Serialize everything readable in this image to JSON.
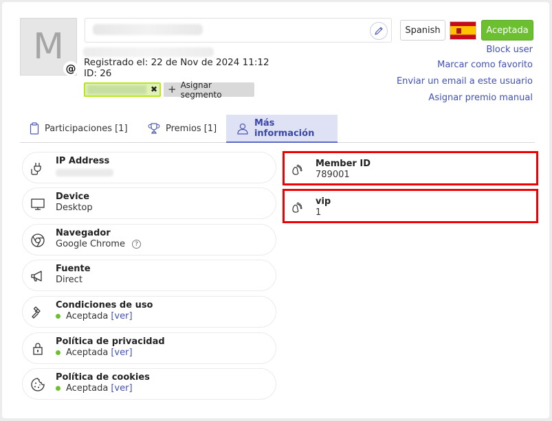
{
  "profile": {
    "avatar_letter": "M",
    "at_symbol": "@",
    "registered": "Registrado el: 22 de Nov de 2024 11:12",
    "id_label": "ID: 26",
    "segment_remove": "✖",
    "assign_segment": "Asignar segmento"
  },
  "header": {
    "language": "Spanish",
    "status": "Aceptada",
    "flag_country": "Spain",
    "colors": {
      "accent": "#4150b5",
      "status_green": "#6cc02f",
      "segment_border": "#b5e81c",
      "highlight_red": "#ee0000"
    }
  },
  "actions": [
    {
      "label": "Block user"
    },
    {
      "label": "Marcar como favorito"
    },
    {
      "label": "Enviar un email a este usuario"
    },
    {
      "label": "Asignar premio manual"
    }
  ],
  "tabs": [
    {
      "label": "Participaciones [1]",
      "icon": "clipboard-icon"
    },
    {
      "label": "Premios [1]",
      "icon": "trophy-icon"
    },
    {
      "label": "Más información",
      "icon": "user-icon",
      "active": true
    }
  ],
  "info": {
    "ip": {
      "title": "IP Address"
    },
    "device": {
      "title": "Device",
      "value": "Desktop"
    },
    "browser": {
      "title": "Navegador",
      "value": "Google Chrome",
      "help": "?"
    },
    "source": {
      "title": "Fuente",
      "value": "Direct"
    },
    "terms": {
      "title": "Condiciones de uso",
      "value": "Aceptada",
      "link": "[ver]"
    },
    "privacy": {
      "title": "Política de privacidad",
      "value": "Aceptada",
      "link": "[ver]"
    },
    "cookies": {
      "title": "Política de cookies",
      "value": "Aceptada",
      "link": "[ver]"
    }
  },
  "custom_fields": [
    {
      "title": "Member ID",
      "value": "789001"
    },
    {
      "title": "vip",
      "value": "1"
    }
  ]
}
